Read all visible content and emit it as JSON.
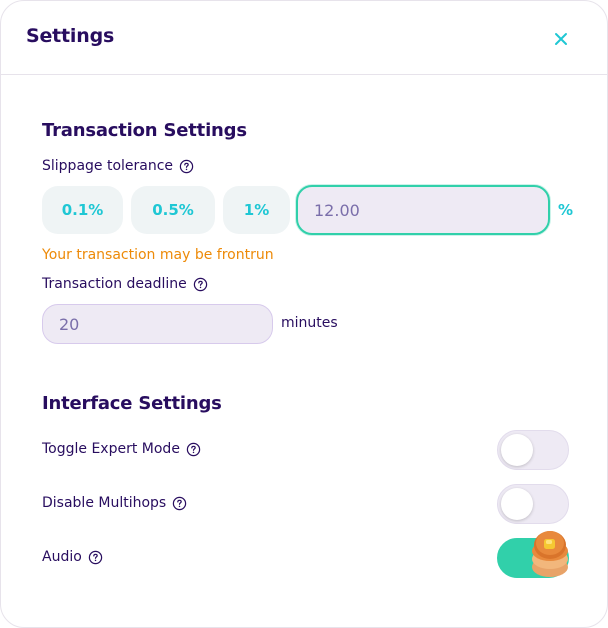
{
  "header": {
    "title": "Settings",
    "close_icon": "close-icon"
  },
  "transaction": {
    "title": "Transaction Settings",
    "slippage_label": "Slippage tolerance",
    "presets": [
      "0.1%",
      "0.5%",
      "1%"
    ],
    "custom_value": "12.00",
    "percent_symbol": "%",
    "warning": "Your transaction may be frontrun",
    "deadline_label": "Transaction deadline",
    "deadline_value": "20",
    "deadline_unit": "minutes"
  },
  "interface": {
    "title": "Interface Settings",
    "expert_mode_label": "Toggle Expert Mode",
    "expert_mode_on": false,
    "multihops_label": "Disable Multihops",
    "multihops_on": false,
    "audio_label": "Audio",
    "audio_on": true
  },
  "colors": {
    "primary_text": "#280d5f",
    "accent": "#1fc7d4",
    "success": "#31d0aa",
    "warning": "#ed8a08",
    "input_bg": "#eeeaf4"
  }
}
